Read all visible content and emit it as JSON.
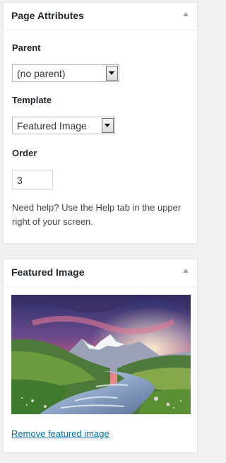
{
  "page_attributes": {
    "title": "Page Attributes",
    "parent_label": "Parent",
    "parent_value": "(no parent)",
    "template_label": "Template",
    "template_value": "Featured Image",
    "order_label": "Order",
    "order_value": "3",
    "help_text": "Need help? Use the Help tab in the upper right of your screen."
  },
  "featured_image": {
    "title": "Featured Image",
    "image_description": "mountain-river-landscape",
    "remove_link": "Remove featured image"
  },
  "colors": {
    "background": "#f1f1f1",
    "panel": "#ffffff",
    "link": "#0073aa",
    "text": "#23282d"
  },
  "icons": {
    "collapse": "triangle-up-icon",
    "dropdown": "chevron-down-icon"
  }
}
